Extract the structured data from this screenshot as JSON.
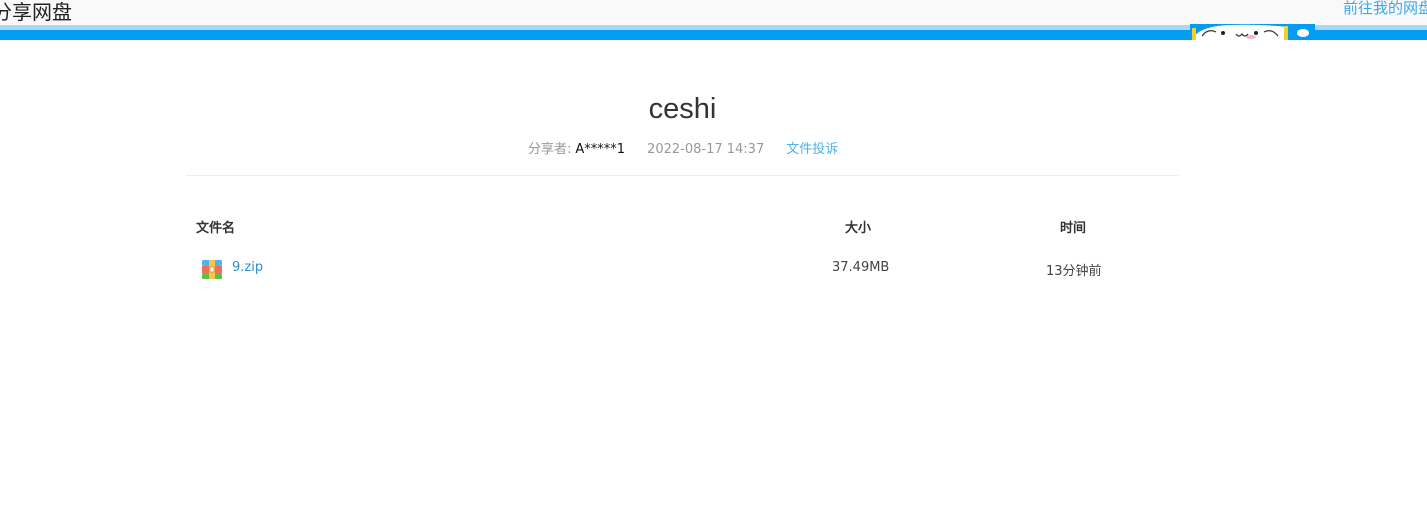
{
  "header": {
    "brand_text": "分享网盘",
    "my_drive_link": "前往我的网盘"
  },
  "colors": {
    "accent_blue": "#039cf2",
    "accent_light": "#a9d8f5",
    "link_blue": "#2b8fd6"
  },
  "share": {
    "title": "ceshi",
    "sharer_label": "分享者:",
    "sharer_name": "A*****1",
    "date": "2022-08-17 14:37",
    "report_link": "文件投诉"
  },
  "table": {
    "headers": {
      "name": "文件名",
      "size": "大小",
      "time": "时间"
    },
    "rows": [
      {
        "icon": "zip-file-icon",
        "name": "9.zip",
        "size": "37.49MB",
        "time": "13分钟前"
      }
    ]
  }
}
